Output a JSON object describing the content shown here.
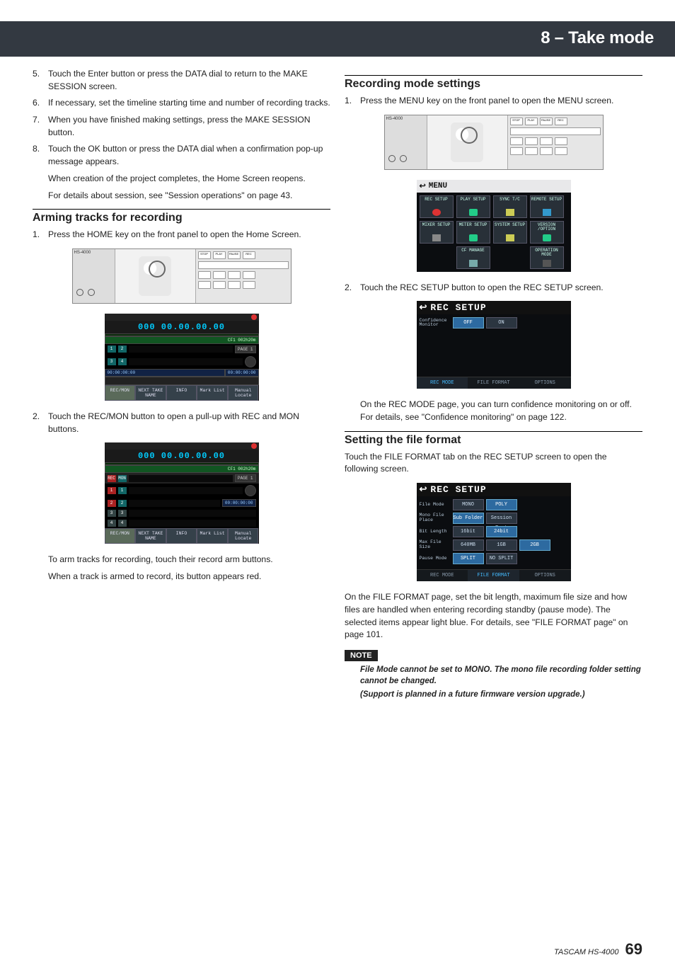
{
  "header": {
    "title": "8 – Take mode"
  },
  "left": {
    "steps_a": [
      {
        "n": "5.",
        "t": "Touch the Enter button or press the DATA dial to return to the MAKE SESSION screen."
      },
      {
        "n": "6.",
        "t": "If necessary, set the timeline starting time and number of recording tracks."
      },
      {
        "n": "7.",
        "t": "When you have finished making settings, press the MAKE SESSION button."
      },
      {
        "n": "8.",
        "t": "Touch the OK button or press the DATA dial when a confirmation pop-up message appears."
      }
    ],
    "subs_a": [
      "When creation of the project completes, the Home Screen reopens.",
      "For details about session, see \"Session operations\" on page 43."
    ],
    "section1": "Arming tracks for recording",
    "step1": {
      "n": "1.",
      "t": "Press the HOME key on the front panel to open the Home Screen."
    },
    "device_model": "HS-4000",
    "home": {
      "tc": "000 00.00.00.00",
      "cf": "CF1  002h20m",
      "btns": [
        "REC/MON",
        "NEXT TAKE NAME",
        "INFO",
        "Mark List",
        "Manual Locate"
      ]
    },
    "step2": {
      "n": "2.",
      "t": "Touch the REC/MON button to open a pull-up with REC and MON buttons."
    },
    "recmon": {
      "tc": "000 00.00.00.00",
      "cf": "CF1  002h20m",
      "labels": [
        "REC",
        "MON"
      ],
      "tracks": [
        "1",
        "2",
        "3",
        "4"
      ],
      "btns": [
        "REC/MON",
        "NEXT TAKE NAME",
        "INFO",
        "Mark List",
        "Manual Locate"
      ]
    },
    "after1": "To arm tracks for recording, touch their record arm buttons.",
    "after2": "When a track is armed to record, its button appears red."
  },
  "right": {
    "section_rec": "Recording mode settings",
    "step1": {
      "n": "1.",
      "t": "Press the MENU key on the front panel to open the MENU screen."
    },
    "device_model": "HS-4000",
    "menu": {
      "title": "MENU",
      "items": [
        "REC SETUP",
        "PLAY SETUP",
        "SYNC T/C",
        "REMOTE SETUP",
        "MIXER SETUP",
        "METER SETUP",
        "SYSTEM SETUP",
        "VERSION /OPTION",
        "",
        "CF MANAGE",
        "",
        "OPERATION MODE"
      ]
    },
    "step2": {
      "n": "2.",
      "t": "Touch the REC SETUP button to open the REC SETUP screen."
    },
    "recsetup1": {
      "title": "REC SETUP",
      "row_label": "Confidence Monitor",
      "opts": [
        "OFF",
        "ON"
      ],
      "tabs": [
        "REC MODE",
        "FILE FORMAT",
        "OPTIONS"
      ]
    },
    "after_rec": "On the REC MODE page, you can turn confidence monitoring on or off. For details, see \"Confidence monitoring\" on page 122.",
    "section_file": "Setting the file format",
    "file_intro": "Touch the FILE FORMAT tab on the REC SETUP screen to open the following screen.",
    "recsetup2": {
      "title": "REC SETUP",
      "rows": [
        {
          "label": "File Mode",
          "opts": [
            "MONO",
            "POLY"
          ],
          "sel": 1
        },
        {
          "label": "Mono File Place",
          "opts": [
            "Sub Folder",
            "Session Root"
          ],
          "sel": 0
        },
        {
          "label": "Bit Length",
          "opts": [
            "16bit",
            "24bit"
          ],
          "sel": 1
        },
        {
          "label": "Max File Size",
          "opts": [
            "640MB",
            "1GB",
            "2GB"
          ],
          "sel": 2
        },
        {
          "label": "Pause Mode",
          "opts": [
            "SPLIT",
            "NO SPLIT"
          ],
          "sel": 0
        }
      ],
      "tabs": [
        "REC MODE",
        "FILE FORMAT",
        "OPTIONS"
      ]
    },
    "after_file": "On the FILE FORMAT page, set the bit length, maximum file size and how files are handled when entering recording standby (pause mode).  The selected items appear light blue. For details, see \"FILE FORMAT page\" on page 101.",
    "note_label": "NOTE",
    "note1": "File Mode cannot be set to MONO. The mono file recording folder setting cannot be changed.",
    "note2": "(Support is planned in a future firmware version upgrade.)"
  },
  "footer": {
    "brand": "TASCAM HS-4000",
    "page": "69"
  }
}
